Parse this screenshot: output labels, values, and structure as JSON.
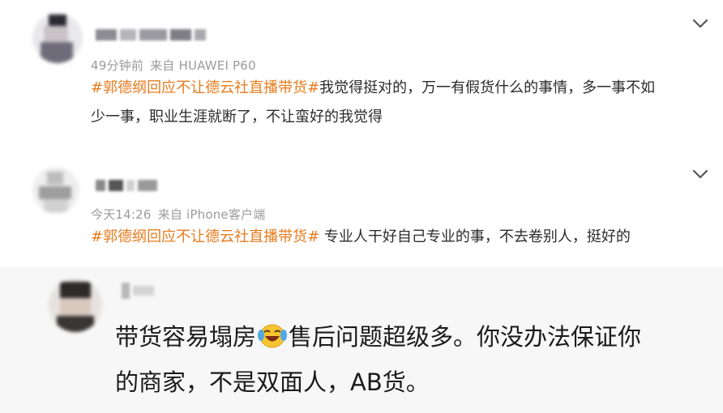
{
  "comments": [
    {
      "time": "49分钟前",
      "source": "来自 HUAWEI P60",
      "hashtag": "#郭德纲回应不让德云社直播带货#",
      "text_line1": "我觉得挺对的，万一有假货什么的事情，多一事不如",
      "text_line2": "少一事，职业生涯就断了，不让蛮好的我觉得",
      "icons": {
        "avatar": "avatar-icon",
        "more": "chevron-down-icon"
      }
    },
    {
      "time": "今天14:26",
      "source": "来自 iPhone客户端",
      "hashtag": "#郭德纲回应不让德云社直播带货#",
      "text_line1": " 专业人干好自己专业的事，不去卷别人，挺好的",
      "icons": {
        "avatar": "avatar-icon",
        "more": "chevron-down-icon"
      }
    },
    {
      "text_line1_before": "带货容易塌房",
      "emoji_name": "laughing-tears-emoji-icon",
      "text_line1_after": "售后问题超级多。你没办法保证你",
      "text_line2": "的商家，不是双面人，AB货。"
    }
  ],
  "colors": {
    "hashtag": "#e87c1e",
    "meta": "#9b9b9b",
    "text": "#2b2b2b"
  }
}
